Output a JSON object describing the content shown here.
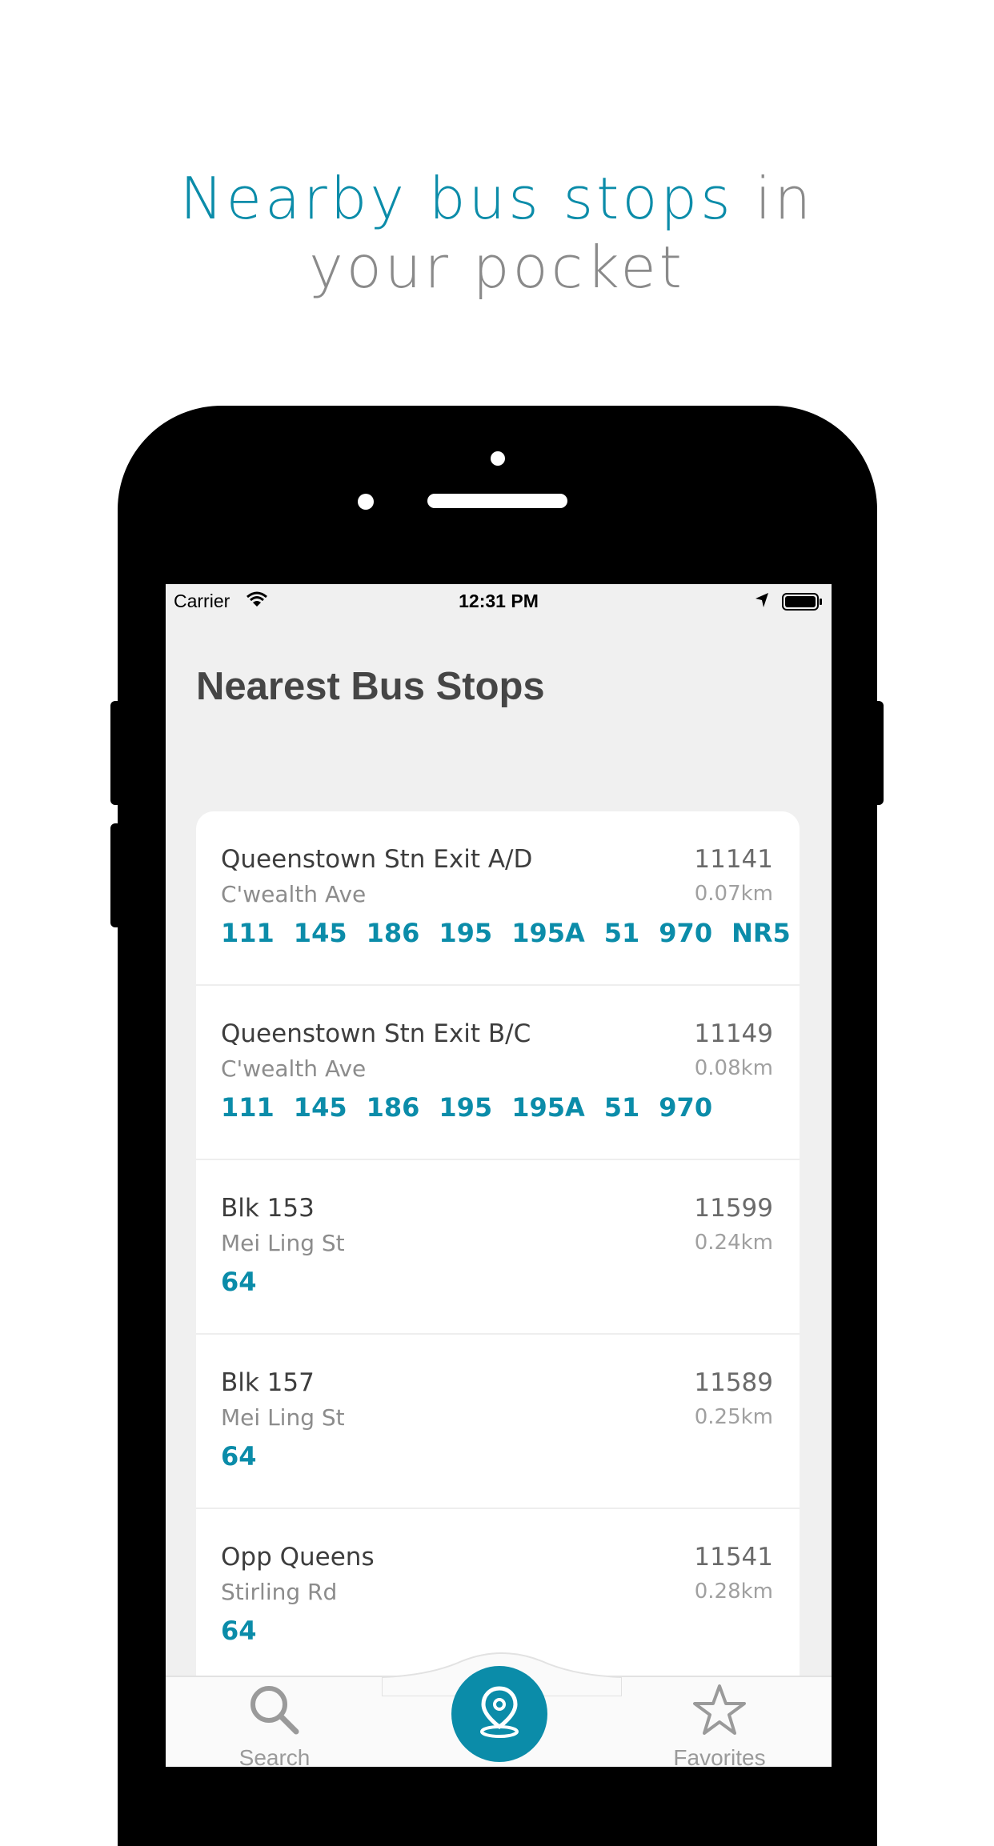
{
  "headline": {
    "accent": "Nearby bus stops",
    "rest_line1": " in",
    "line2": "your pocket"
  },
  "status_bar": {
    "carrier": "Carrier",
    "time": "12:31 PM"
  },
  "page_title": "Nearest Bus Stops",
  "stops": [
    {
      "name": "Queenstown Stn Exit A/D",
      "road": "C'wealth Ave",
      "code": "11141",
      "distance": "0.07km",
      "services": [
        "111",
        "145",
        "186",
        "195",
        "195A",
        "51",
        "970",
        "NR5"
      ]
    },
    {
      "name": "Queenstown Stn Exit B/C",
      "road": "C'wealth Ave",
      "code": "11149",
      "distance": "0.08km",
      "services": [
        "111",
        "145",
        "186",
        "195",
        "195A",
        "51",
        "970"
      ]
    },
    {
      "name": "Blk 153",
      "road": "Mei Ling St",
      "code": "11599",
      "distance": "0.24km",
      "services": [
        "64"
      ]
    },
    {
      "name": "Blk 157",
      "road": "Mei Ling St",
      "code": "11589",
      "distance": "0.25km",
      "services": [
        "64"
      ]
    },
    {
      "name": "Opp Queens",
      "road": "Stirling Rd",
      "code": "11541",
      "distance": "0.28km",
      "services": [
        "64"
      ]
    }
  ],
  "tabs": {
    "search_label": "Search",
    "nearby_icon": "location-pin-icon",
    "favorites_label": "Favorites"
  },
  "colors": {
    "accent": "#0b8ca9",
    "muted": "#8a8a8a"
  }
}
